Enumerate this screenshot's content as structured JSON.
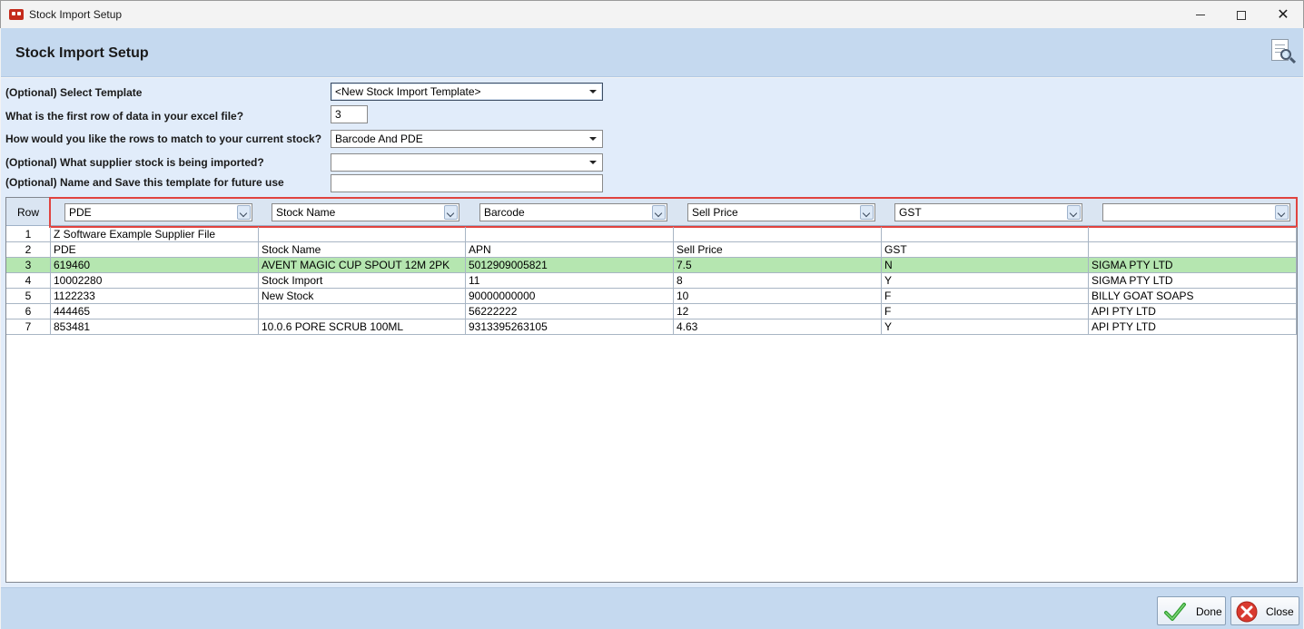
{
  "window": {
    "title": "Stock Import Setup",
    "minimize": "minimize",
    "maximize": "maximize",
    "close": "✕"
  },
  "header": {
    "title": "Stock Import Setup",
    "icon": "document-search-icon"
  },
  "form": {
    "template_label": "(Optional) Select Template",
    "template_value": "<New Stock Import Template>",
    "first_row_label": "What is the first row of data in your excel file?",
    "first_row_value": "3",
    "match_label": "How would you like the rows to match to your current stock?",
    "match_value": "Barcode And PDE",
    "supplier_label": "(Optional) What supplier stock is being imported?",
    "supplier_value": "",
    "save_name_label": "(Optional) Name and Save this template for future use",
    "save_name_value": ""
  },
  "grid": {
    "row_header": "Row",
    "column_mappings": [
      "PDE",
      "Stock Name",
      "Barcode",
      "Sell Price",
      "GST",
      ""
    ],
    "rows": [
      [
        "1",
        "Z Software Example Supplier File",
        "",
        "",
        "",
        "",
        ""
      ],
      [
        "2",
        "PDE",
        "Stock Name",
        "APN",
        "Sell Price",
        "GST",
        ""
      ],
      [
        "3",
        "619460",
        "AVENT MAGIC CUP SPOUT 12M 2PK",
        "5012909005821",
        "7.5",
        "N",
        "SIGMA PTY LTD"
      ],
      [
        "4",
        "10002280",
        "Stock Import",
        "11",
        "8",
        "Y",
        "SIGMA PTY LTD"
      ],
      [
        "5",
        "1122233",
        "New Stock",
        "90000000000",
        "10",
        "F",
        "BILLY GOAT SOAPS"
      ],
      [
        "6",
        "444465",
        "",
        "56222222",
        "12",
        "F",
        "API PTY LTD"
      ],
      [
        "7",
        "853481",
        "10.0.6 PORE SCRUB 100ML",
        "9313395263105",
        "4.63",
        "Y",
        "API PTY LTD"
      ]
    ],
    "selected_row": "3",
    "colors": {
      "selected_row": "#b5e6b0",
      "highlight_border": "#e0433f"
    }
  },
  "footer": {
    "done_label": "Done",
    "close_label": "Close"
  }
}
